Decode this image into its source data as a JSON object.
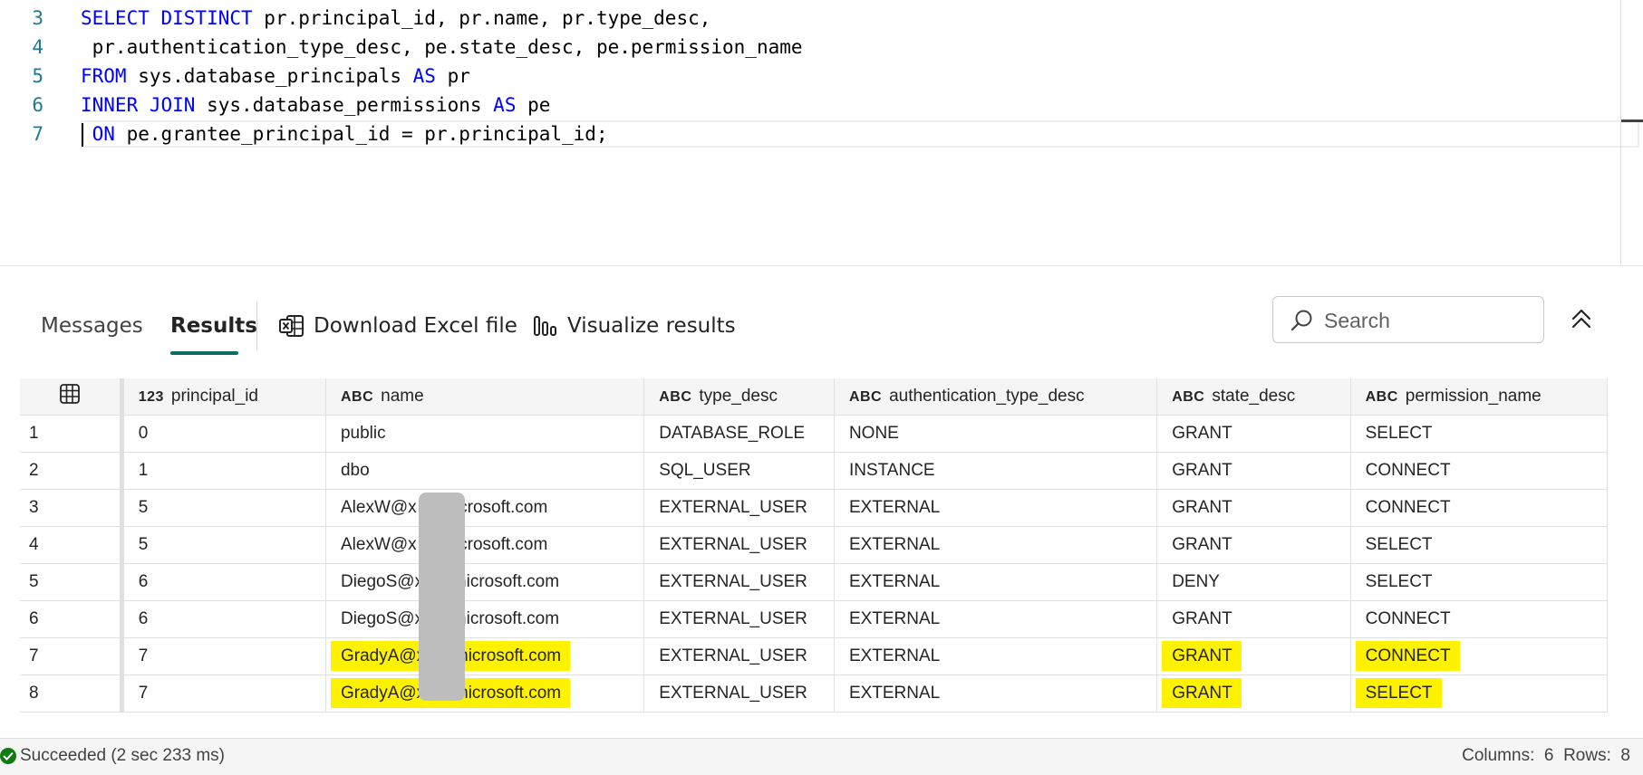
{
  "editor": {
    "lines": [
      {
        "num": "3",
        "parts": [
          {
            "t": "SELECT DISTINCT",
            "kw": true
          },
          {
            "t": " pr.principal_id, pr.name, pr.type_desc,",
            "kw": false
          }
        ]
      },
      {
        "num": "4",
        "parts": [
          {
            "t": " pr.authentication_type_desc, pe.state_desc, pe.permission_name",
            "kw": false
          }
        ]
      },
      {
        "num": "5",
        "parts": [
          {
            "t": "FROM",
            "kw": true
          },
          {
            "t": " sys.database_principals ",
            "kw": false
          },
          {
            "t": "AS",
            "kw": true
          },
          {
            "t": " pr",
            "kw": false
          }
        ]
      },
      {
        "num": "6",
        "parts": [
          {
            "t": "INNER JOIN",
            "kw": true
          },
          {
            "t": " sys.database_permissions ",
            "kw": false
          },
          {
            "t": "AS",
            "kw": true
          },
          {
            "t": " pe",
            "kw": false
          }
        ]
      },
      {
        "num": "7",
        "parts": [
          {
            "t": " ON",
            "kw": true
          },
          {
            "t": " pe.grantee_principal_id = pr.principal_id;",
            "kw": false
          }
        ]
      }
    ]
  },
  "toolbar": {
    "tabs": [
      "Messages",
      "Results"
    ],
    "active_tab": "Results",
    "download_label": "Download Excel file",
    "visualize_label": "Visualize results",
    "search_placeholder": "Search"
  },
  "grid": {
    "columns": [
      {
        "type": "123",
        "name": "principal_id"
      },
      {
        "type": "ABC",
        "name": "name"
      },
      {
        "type": "ABC",
        "name": "type_desc"
      },
      {
        "type": "ABC",
        "name": "authentication_type_desc"
      },
      {
        "type": "ABC",
        "name": "state_desc"
      },
      {
        "type": "ABC",
        "name": "permission_name"
      }
    ],
    "rows": [
      {
        "n": "1",
        "cells": [
          "0",
          "public",
          "DATABASE_ROLE",
          "NONE",
          "GRANT",
          "SELECT"
        ],
        "highlight": false
      },
      {
        "n": "2",
        "cells": [
          "1",
          "dbo",
          "SQL_USER",
          "INSTANCE",
          "GRANT",
          "CONNECT"
        ],
        "highlight": false
      },
      {
        "n": "3",
        "cells": [
          "5",
          "AlexW@x onmicrosoft.com",
          "EXTERNAL_USER",
          "EXTERNAL",
          "GRANT",
          "CONNECT"
        ],
        "highlight": false
      },
      {
        "n": "4",
        "cells": [
          "5",
          "AlexW@x onmicrosoft.com",
          "EXTERNAL_USER",
          "EXTERNAL",
          "GRANT",
          "SELECT"
        ],
        "highlight": false
      },
      {
        "n": "5",
        "cells": [
          "6",
          "DiegoS@x .onmicrosoft.com",
          "EXTERNAL_USER",
          "EXTERNAL",
          "DENY",
          "SELECT"
        ],
        "highlight": false
      },
      {
        "n": "6",
        "cells": [
          "6",
          "DiegoS@x .onmicrosoft.com",
          "EXTERNAL_USER",
          "EXTERNAL",
          "GRANT",
          "CONNECT"
        ],
        "highlight": false
      },
      {
        "n": "7",
        "cells": [
          "7",
          "GradyA@x .onmicrosoft.com",
          "EXTERNAL_USER",
          "EXTERNAL",
          "GRANT",
          "CONNECT"
        ],
        "highlight": true
      },
      {
        "n": "8",
        "cells": [
          "7",
          "GradyA@x .onmicrosoft.com",
          "EXTERNAL_USER",
          "EXTERNAL",
          "GRANT",
          "SELECT"
        ],
        "highlight": true
      }
    ],
    "highlight_color": "#fff200"
  },
  "status": {
    "message": "Succeeded (2 sec 233 ms)",
    "columns_label": "Columns:",
    "columns": "6",
    "rows_label": "Rows:",
    "rows": "8"
  }
}
